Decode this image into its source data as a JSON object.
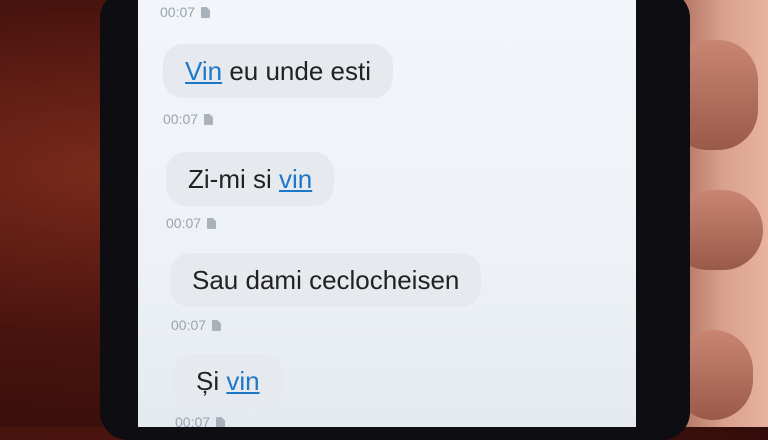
{
  "messages": [
    {
      "time": "00:07"
    },
    {
      "before": "",
      "link": "Vin",
      "after": " eu unde esti",
      "time": "00:07"
    },
    {
      "before": "Zi-mi si ",
      "link": "vin",
      "after": "",
      "time": "00:07"
    },
    {
      "before": "Sau dami ceclocheisen",
      "link": "",
      "after": "",
      "time": "00:07"
    },
    {
      "before": "Și ",
      "link": "vin",
      "after": "",
      "time": "00:07"
    }
  ],
  "icons": {
    "sim": "sim-card-icon"
  }
}
